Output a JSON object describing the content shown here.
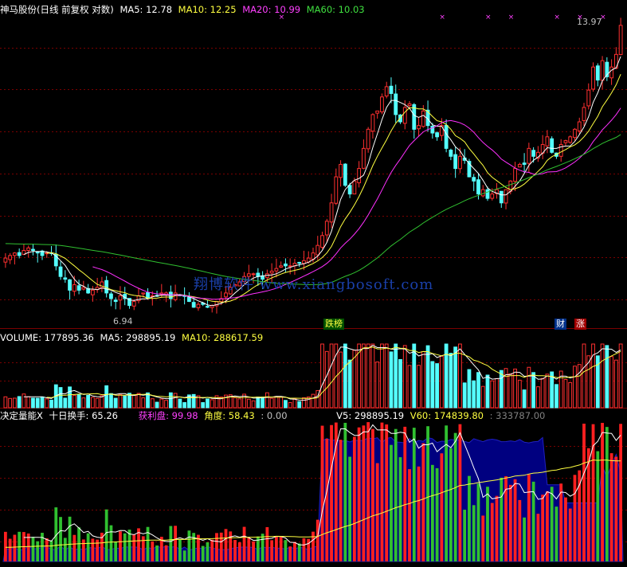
{
  "colors": {
    "background": "#000000",
    "grid": "#7a0000",
    "candle_up": "#ff3030",
    "candle_down": "#54ffff",
    "ma5": "#ffffff",
    "ma10": "#ffff40",
    "ma20": "#ff30ff",
    "ma60": "#30c030",
    "profit_fill": "#000080",
    "vol_bar_green": "#30c030",
    "vol_bar_red": "#ff2020"
  },
  "price_panel": {
    "stock": "神马股份(日线 前复权 对数)",
    "ma5": "MA5: 12.78",
    "ma10": "MA10: 12.25",
    "ma20": "MA20: 10.99",
    "ma60": "MA60: 10.03",
    "high_label": "13.97",
    "low_label": "6.94",
    "tag_die": "跌榜",
    "tag_cai": "财",
    "tag_zhang": "涨",
    "watermark": "翔博软件 www.xiangbosoft.com"
  },
  "volume_panel": {
    "volume": "VOLUME: 177895.36",
    "ma5": "MA5: 298895.19",
    "ma10": "MA10: 288617.59"
  },
  "indicator_panel": {
    "name": "决定量能X",
    "turnover": "十日换手: 65.26",
    "profit": "获利盘: 99.98",
    "angle": "角度: 58.43",
    "zero": ": 0.00",
    "v5": "V5: 298895.19",
    "v60": "V60: 174839.80",
    "extra": ": 333787.00"
  },
  "chart_data": [
    {
      "type": "candlestick",
      "title": "神马股份(日线 前复权 对数)",
      "scale": "log",
      "ylim": [
        6.6,
        14.3
      ],
      "grid": true,
      "series": [
        {
          "name": "MA5",
          "last": 12.78
        },
        {
          "name": "MA10",
          "last": 12.25
        },
        {
          "name": "MA20",
          "last": 10.99
        },
        {
          "name": "MA60",
          "last": 10.03
        }
      ],
      "annotations": {
        "low": 6.94,
        "high": 13.97
      },
      "close": [
        7.85,
        7.9,
        7.95,
        7.9,
        8.0,
        8.05,
        8.0,
        7.95,
        7.9,
        7.95,
        7.95,
        7.7,
        7.5,
        7.45,
        7.25,
        7.35,
        7.25,
        7.3,
        7.2,
        7.25,
        7.3,
        7.4,
        7.2,
        7.1,
        7.05,
        7.15,
        7.1,
        6.98,
        7.05,
        7.15,
        7.2,
        7.1,
        7.15,
        7.15,
        7.2,
        7.2,
        7.1,
        7.2,
        7.15,
        7.15,
        7.05,
        6.95,
        7.0,
        7.0,
        6.95,
        6.98,
        7.05,
        7.1,
        7.2,
        7.3,
        7.35,
        7.4,
        7.5,
        7.55,
        7.55,
        7.5,
        7.45,
        7.55,
        7.6,
        7.65,
        7.7,
        7.7,
        7.7,
        7.75,
        7.75,
        7.8,
        7.85,
        7.95,
        8.1,
        8.3,
        8.6,
        9.0,
        9.6,
        9.9,
        9.4,
        9.2,
        9.5,
        9.8,
        10.3,
        10.8,
        11.2,
        11.3,
        11.7,
        12.0,
        11.8,
        11.2,
        11.0,
        11.4,
        11.5,
        10.8,
        10.9,
        11.3,
        10.9,
        10.7,
        10.6,
        10.9,
        10.3,
        10.1,
        9.8,
        10.1,
        10.0,
        9.6,
        9.5,
        9.2,
        9.3,
        9.1,
        9.2,
        9.3,
        9.0,
        9.3,
        9.5,
        9.8,
        9.9,
        9.9,
        10.3,
        10.1,
        10.2,
        10.4,
        10.6,
        10.2,
        10.1,
        10.4,
        10.5,
        10.6,
        10.8,
        11.0,
        11.4,
        11.9,
        12.6,
        12.2,
        12.8,
        12.3,
        12.6,
        13.0,
        13.97
      ],
      "vol_last": 177895.36,
      "vol_ma5": 298895.19,
      "vol_ma10": 288617.59
    },
    {
      "type": "bar",
      "title": "决定量能X",
      "series": [
        {
          "name": "十日换手",
          "last": 65.26
        },
        {
          "name": "获利盘",
          "last": 99.98
        },
        {
          "name": "角度",
          "last": 58.43
        },
        {
          "name": "V5",
          "last": 298895.19
        },
        {
          "name": "V60",
          "last": 174839.8
        }
      ]
    }
  ]
}
